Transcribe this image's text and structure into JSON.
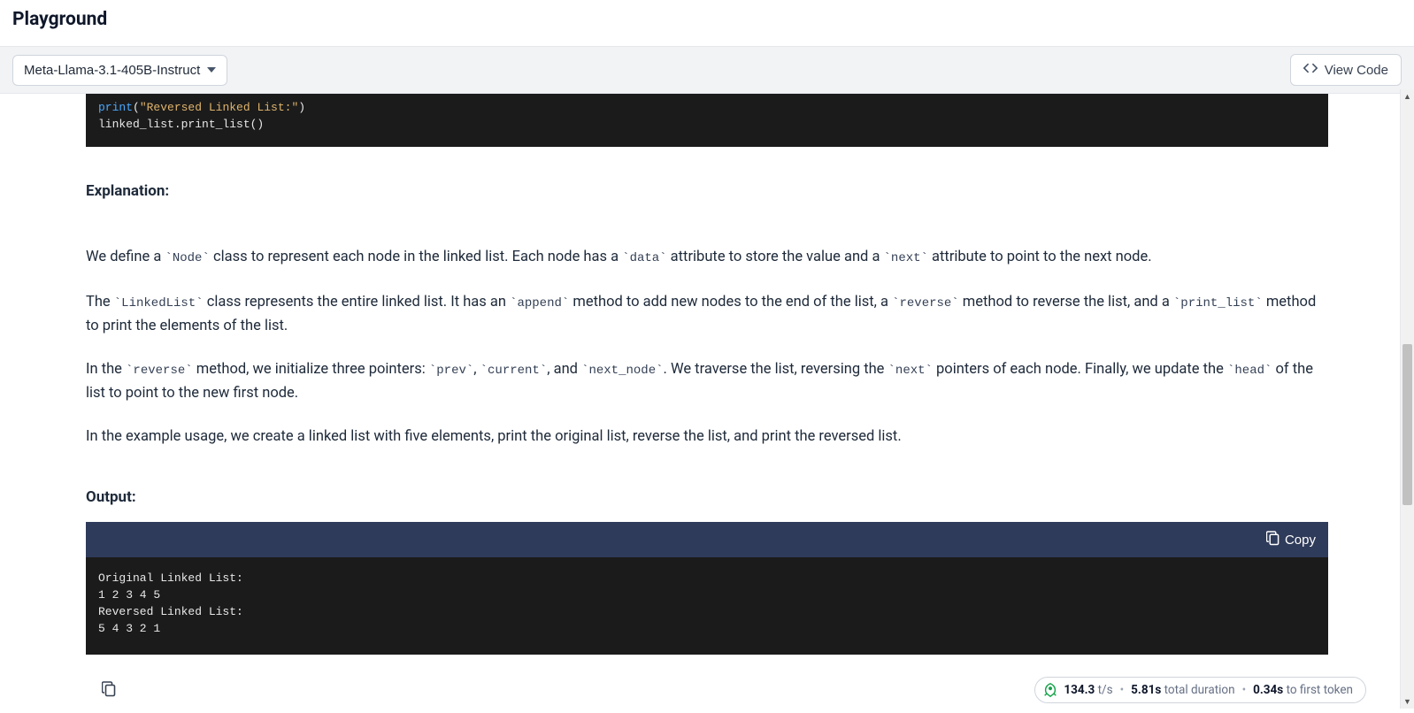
{
  "header": {
    "title": "Playground"
  },
  "toolbar": {
    "model_label": "Meta-Llama-3.1-405B-Instruct",
    "view_code_label": "View Code"
  },
  "content": {
    "code_partial_line1_kw": "print",
    "code_partial_line1_paren_open": "(",
    "code_partial_line1_str": "\"Reversed Linked List:\"",
    "code_partial_line1_paren_close": ")",
    "code_partial_line2": "linked_list.print_list()",
    "explanation_heading": "Explanation:",
    "para1_a": "We define a ",
    "para1_c1": "`Node`",
    "para1_b": " class to represent each node in the linked list. Each node has a ",
    "para1_c2": "`data`",
    "para1_c": " attribute to store the value and a ",
    "para1_c3": "`next`",
    "para1_d": " attribute to point to the next node.",
    "para2_a": "The ",
    "para2_c1": "`LinkedList`",
    "para2_b": " class represents the entire linked list. It has an ",
    "para2_c2": "`append`",
    "para2_c": " method to add new nodes to the end of the list, a ",
    "para2_c3": "`reverse`",
    "para2_d": " method to reverse the list, and a ",
    "para2_c4": "`print_list`",
    "para2_e": " method to print the elements of the list.",
    "para3_a": "In the ",
    "para3_c1": "`reverse`",
    "para3_b": " method, we initialize three pointers: ",
    "para3_c2": "`prev`",
    "para3_c": ", ",
    "para3_c3": "`current`",
    "para3_d": ", and ",
    "para3_c4": "`next_node`",
    "para3_e": ". We traverse the list, reversing the ",
    "para3_c5": "`next`",
    "para3_f": " pointers of each node. Finally, we update the ",
    "para3_c6": "`head`",
    "para3_g": " of the list to point to the new first node.",
    "para4": "In the example usage, we create a linked list with five elements, print the original list, reverse the list, and print the reversed list.",
    "output_heading": "Output:",
    "copy_label": "Copy",
    "output_body": "Original Linked List:\n1 2 3 4 5\nReversed Linked List:\n5 4 3 2 1"
  },
  "footer": {
    "rate_num": "134.3",
    "rate_unit": " t/s",
    "sep": " • ",
    "total_num": "5.81s",
    "total_label": " total duration",
    "first_num": "0.34s",
    "first_label": " to first token"
  }
}
